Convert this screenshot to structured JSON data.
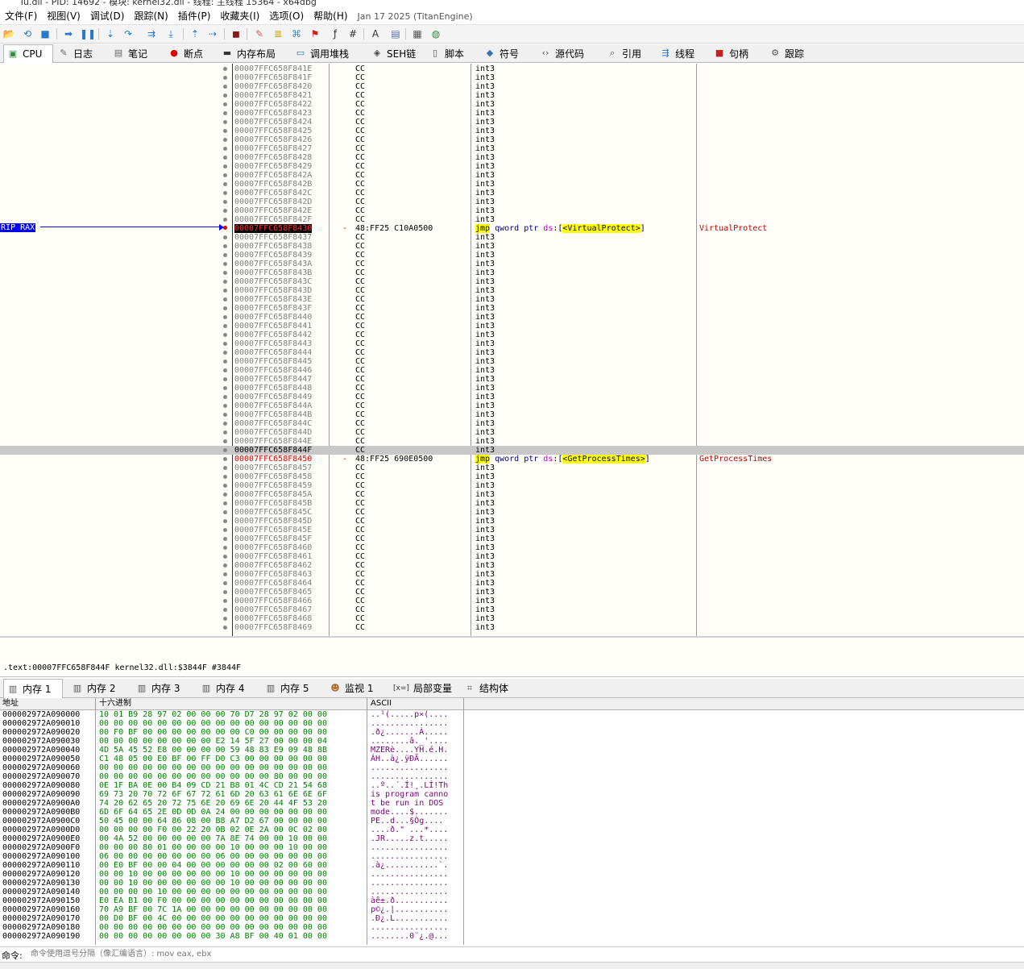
{
  "window": {
    "title": "Tu.dll - PID: 14692 - 模块: kernel32.dll - 线程: 主线程 15364 - x64dbg"
  },
  "menu": {
    "items": [
      "文件(F)",
      "视图(V)",
      "调试(D)",
      "跟踪(N)",
      "插件(P)",
      "收藏夹(I)",
      "选项(O)",
      "帮助(H)"
    ],
    "build_info": "Jan 17 2025 (TitanEngine)"
  },
  "toolbar": {
    "icons": [
      "open-icon",
      "restart-icon",
      "stop-icon",
      "run-icon",
      "pause-icon",
      "step-into-icon",
      "step-over-icon",
      "trace-into-icon",
      "trace-over-icon",
      "execute-till-return-icon",
      "run-to-user-code-icon",
      "scylla-icon",
      "comment-icon",
      "label-icon",
      "bookmark-icon",
      "function-icon",
      "hash-icon",
      "fx-icon",
      "font-icon",
      "patch-icon",
      "calculator-icon",
      "globe-icon"
    ]
  },
  "tabs": [
    {
      "label": "CPU",
      "icon": "cpu-icon",
      "active": true
    },
    {
      "label": "日志",
      "icon": "log-icon"
    },
    {
      "label": "笔记",
      "icon": "notes-icon"
    },
    {
      "label": "断点",
      "icon": "breakpoint-icon"
    },
    {
      "label": "内存布局",
      "icon": "memory-map-icon"
    },
    {
      "label": "调用堆栈",
      "icon": "call-stack-icon"
    },
    {
      "label": "SEH链",
      "icon": "seh-icon"
    },
    {
      "label": "脚本",
      "icon": "script-icon"
    },
    {
      "label": "符号",
      "icon": "symbols-icon"
    },
    {
      "label": "源代码",
      "icon": "source-icon"
    },
    {
      "label": "引用",
      "icon": "references-icon"
    },
    {
      "label": "线程",
      "icon": "threads-icon"
    },
    {
      "label": "句柄",
      "icon": "handles-icon"
    },
    {
      "label": "跟踪",
      "icon": "trace-icon"
    }
  ],
  "disasm": {
    "rip_label": "RIP RAX",
    "rows": [
      {
        "addr": "00007FFC658F841E",
        "bytes": "CC",
        "instr": "int3"
      },
      {
        "addr": "00007FFC658F841F",
        "bytes": "CC",
        "instr": "int3"
      },
      {
        "addr": "00007FFC658F8420",
        "bytes": "CC",
        "instr": "int3"
      },
      {
        "addr": "00007FFC658F8421",
        "bytes": "CC",
        "instr": "int3"
      },
      {
        "addr": "00007FFC658F8422",
        "bytes": "CC",
        "instr": "int3"
      },
      {
        "addr": "00007FFC658F8423",
        "bytes": "CC",
        "instr": "int3"
      },
      {
        "addr": "00007FFC658F8424",
        "bytes": "CC",
        "instr": "int3"
      },
      {
        "addr": "00007FFC658F8425",
        "bytes": "CC",
        "instr": "int3"
      },
      {
        "addr": "00007FFC658F8426",
        "bytes": "CC",
        "instr": "int3"
      },
      {
        "addr": "00007FFC658F8427",
        "bytes": "CC",
        "instr": "int3"
      },
      {
        "addr": "00007FFC658F8428",
        "bytes": "CC",
        "instr": "int3"
      },
      {
        "addr": "00007FFC658F8429",
        "bytes": "CC",
        "instr": "int3"
      },
      {
        "addr": "00007FFC658F842A",
        "bytes": "CC",
        "instr": "int3"
      },
      {
        "addr": "00007FFC658F842B",
        "bytes": "CC",
        "instr": "int3"
      },
      {
        "addr": "00007FFC658F842C",
        "bytes": "CC",
        "instr": "int3"
      },
      {
        "addr": "00007FFC658F842D",
        "bytes": "CC",
        "instr": "int3"
      },
      {
        "addr": "00007FFC658F842E",
        "bytes": "CC",
        "instr": "int3"
      },
      {
        "addr": "00007FFC658F842F",
        "bytes": "CC",
        "instr": "int3"
      },
      {
        "addr": "00007FFC658F8430",
        "bytes": "48:FF25 C10A0500",
        "instr": "jmp qword ptr ds:[<VirtualProtect>]",
        "op": "jmp",
        "mid": " qword ptr ",
        "seg": "ds",
        "sym": "<VirtualProtect>",
        "comment": "VirtualProtect",
        "rip": true,
        "arrow": "-"
      },
      {
        "addr": "00007FFC658F8437",
        "bytes": "CC",
        "instr": "int3"
      },
      {
        "addr": "00007FFC658F8438",
        "bytes": "CC",
        "instr": "int3"
      },
      {
        "addr": "00007FFC658F8439",
        "bytes": "CC",
        "instr": "int3"
      },
      {
        "addr": "00007FFC658F843A",
        "bytes": "CC",
        "instr": "int3"
      },
      {
        "addr": "00007FFC658F843B",
        "bytes": "CC",
        "instr": "int3"
      },
      {
        "addr": "00007FFC658F843C",
        "bytes": "CC",
        "instr": "int3"
      },
      {
        "addr": "00007FFC658F843D",
        "bytes": "CC",
        "instr": "int3"
      },
      {
        "addr": "00007FFC658F843E",
        "bytes": "CC",
        "instr": "int3"
      },
      {
        "addr": "00007FFC658F843F",
        "bytes": "CC",
        "instr": "int3"
      },
      {
        "addr": "00007FFC658F8440",
        "bytes": "CC",
        "instr": "int3"
      },
      {
        "addr": "00007FFC658F8441",
        "bytes": "CC",
        "instr": "int3"
      },
      {
        "addr": "00007FFC658F8442",
        "bytes": "CC",
        "instr": "int3"
      },
      {
        "addr": "00007FFC658F8443",
        "bytes": "CC",
        "instr": "int3"
      },
      {
        "addr": "00007FFC658F8444",
        "bytes": "CC",
        "instr": "int3"
      },
      {
        "addr": "00007FFC658F8445",
        "bytes": "CC",
        "instr": "int3"
      },
      {
        "addr": "00007FFC658F8446",
        "bytes": "CC",
        "instr": "int3"
      },
      {
        "addr": "00007FFC658F8447",
        "bytes": "CC",
        "instr": "int3"
      },
      {
        "addr": "00007FFC658F8448",
        "bytes": "CC",
        "instr": "int3"
      },
      {
        "addr": "00007FFC658F8449",
        "bytes": "CC",
        "instr": "int3"
      },
      {
        "addr": "00007FFC658F844A",
        "bytes": "CC",
        "instr": "int3"
      },
      {
        "addr": "00007FFC658F844B",
        "bytes": "CC",
        "instr": "int3"
      },
      {
        "addr": "00007FFC658F844C",
        "bytes": "CC",
        "instr": "int3"
      },
      {
        "addr": "00007FFC658F844D",
        "bytes": "CC",
        "instr": "int3"
      },
      {
        "addr": "00007FFC658F844E",
        "bytes": "CC",
        "instr": "int3"
      },
      {
        "addr": "00007FFC658F844F",
        "bytes": "CC",
        "instr": "int3",
        "selected": true
      },
      {
        "addr": "00007FFC658F8450",
        "bytes": "48:FF25 690E0500",
        "instr": "jmp qword ptr ds:[<GetProcessTimes>]",
        "op": "jmp",
        "mid": " qword ptr ",
        "seg": "ds",
        "sym": "<GetProcessTimes>",
        "comment": "GetProcessTimes",
        "arrow": "-",
        "redaddr": true
      },
      {
        "addr": "00007FFC658F8457",
        "bytes": "CC",
        "instr": "int3"
      },
      {
        "addr": "00007FFC658F8458",
        "bytes": "CC",
        "instr": "int3"
      },
      {
        "addr": "00007FFC658F8459",
        "bytes": "CC",
        "instr": "int3"
      },
      {
        "addr": "00007FFC658F845A",
        "bytes": "CC",
        "instr": "int3"
      },
      {
        "addr": "00007FFC658F845B",
        "bytes": "CC",
        "instr": "int3"
      },
      {
        "addr": "00007FFC658F845C",
        "bytes": "CC",
        "instr": "int3"
      },
      {
        "addr": "00007FFC658F845D",
        "bytes": "CC",
        "instr": "int3"
      },
      {
        "addr": "00007FFC658F845E",
        "bytes": "CC",
        "instr": "int3"
      },
      {
        "addr": "00007FFC658F845F",
        "bytes": "CC",
        "instr": "int3"
      },
      {
        "addr": "00007FFC658F8460",
        "bytes": "CC",
        "instr": "int3"
      },
      {
        "addr": "00007FFC658F8461",
        "bytes": "CC",
        "instr": "int3"
      },
      {
        "addr": "00007FFC658F8462",
        "bytes": "CC",
        "instr": "int3"
      },
      {
        "addr": "00007FFC658F8463",
        "bytes": "CC",
        "instr": "int3"
      },
      {
        "addr": "00007FFC658F8464",
        "bytes": "CC",
        "instr": "int3"
      },
      {
        "addr": "00007FFC658F8465",
        "bytes": "CC",
        "instr": "int3"
      },
      {
        "addr": "00007FFC658F8466",
        "bytes": "CC",
        "instr": "int3"
      },
      {
        "addr": "00007FFC658F8467",
        "bytes": "CC",
        "instr": "int3"
      },
      {
        "addr": "00007FFC658F8468",
        "bytes": "CC",
        "instr": "int3"
      },
      {
        "addr": "00007FFC658F8469",
        "bytes": "CC",
        "instr": "int3"
      }
    ]
  },
  "info": {
    "text": ".text:00007FFC658F844F kernel32.dll:$3844F #3844F"
  },
  "bottom_tabs": [
    {
      "label": "内存 1",
      "icon": "memory-icon",
      "active": true
    },
    {
      "label": "内存 2",
      "icon": "memory-icon"
    },
    {
      "label": "内存 3",
      "icon": "memory-icon"
    },
    {
      "label": "内存 4",
      "icon": "memory-icon"
    },
    {
      "label": "内存 5",
      "icon": "memory-icon"
    },
    {
      "label": "监视 1",
      "icon": "watch-icon"
    },
    {
      "label": "局部变量",
      "icon": "locals-icon"
    },
    {
      "label": "结构体",
      "icon": "struct-icon"
    }
  ],
  "dump": {
    "headers": {
      "addr": "地址",
      "hex": "十六进制",
      "ascii": "ASCII"
    },
    "rows": [
      {
        "a": "000002972A090000",
        "h": "10 01 B9 28 97 02 00 00 00 70 D7 28 97 02 00 00",
        "s": "..¹(.....p×(...."
      },
      {
        "a": "000002972A090010",
        "h": "00 00 00 00 00 00 00 00 00 00 00 00 00 00 00 00",
        "s": "................"
      },
      {
        "a": "000002972A090020",
        "h": "00 F0 BF 00 00 00 00 00 00 00 C0 00 00 00 00 00",
        "s": ".ð¿.......À....."
      },
      {
        "a": "000002972A090030",
        "h": "00 00 00 00 00 00 00 00 E2 14 5F 27 00 00 00 04",
        "s": "........â._'...."
      },
      {
        "a": "000002972A090040",
        "h": "4D 5A 45 52 E8 00 00 00 00 59 48 83 E9 09 48 8B",
        "s": "MZERè....YH.é.H."
      },
      {
        "a": "000002972A090050",
        "h": "C1 48 05 00 E0 BF 00 FF D0 C3 00 00 00 00 00 00",
        "s": "ÁH..à¿.ÿÐÃ......"
      },
      {
        "a": "000002972A090060",
        "h": "00 00 00 00 00 00 00 00 00 00 00 00 00 00 00 00",
        "s": "................"
      },
      {
        "a": "000002972A090070",
        "h": "00 00 00 00 00 00 00 00 00 00 00 00 80 00 00 00",
        "s": "................"
      },
      {
        "a": "000002972A090080",
        "h": "0E 1F BA 0E 00 B4 09 CD 21 B8 01 4C CD 21 54 68",
        "s": "..º..´.Í!¸.LÍ!Th"
      },
      {
        "a": "000002972A090090",
        "h": "69 73 20 70 72 6F 67 72 61 6D 20 63 61 6E 6E 6F",
        "s": "is program canno"
      },
      {
        "a": "000002972A0900A0",
        "h": "74 20 62 65 20 72 75 6E 20 69 6E 20 44 4F 53 20",
        "s": "t be run in DOS "
      },
      {
        "a": "000002972A0900B0",
        "h": "6D 6F 64 65 2E 0D 0D 0A 24 00 00 00 00 00 00 00",
        "s": "mode....$......."
      },
      {
        "a": "000002972A0900C0",
        "h": "50 45 00 00 64 86 08 00 B8 A7 D2 67 00 00 00 00",
        "s": "PE..d...§Òg...."
      },
      {
        "a": "000002972A0900D0",
        "h": "00 00 00 00 F0 00 22 20 0B 02 0E 2A 00 0C 02 00",
        "s": "....ð.\" ...*...."
      },
      {
        "a": "000002972A0900E0",
        "h": "00 4A 52 00 00 00 00 00 7A 8E 74 00 00 10 00 00",
        "s": ".JR.....z.t....."
      },
      {
        "a": "000002972A0900F0",
        "h": "00 00 00 80 01 00 00 00 00 10 00 00 00 10 00 00",
        "s": "................"
      },
      {
        "a": "000002972A090100",
        "h": "06 00 00 00 00 00 00 00 06 00 00 00 00 00 00 00",
        "s": "................"
      },
      {
        "a": "000002972A090110",
        "h": "00 E0 BF 00 00 04 00 00 00 00 00 00 02 00 60 00",
        "s": ".à¿...........`."
      },
      {
        "a": "000002972A090120",
        "h": "00 00 10 00 00 00 00 00 00 10 00 00 00 00 00 00",
        "s": "................"
      },
      {
        "a": "000002972A090130",
        "h": "00 00 10 00 00 00 00 00 00 10 00 00 00 00 00 00",
        "s": "................"
      },
      {
        "a": "000002972A090140",
        "h": "00 00 00 00 10 00 00 00 00 00 00 00 00 00 00 00",
        "s": "................"
      },
      {
        "a": "000002972A090150",
        "h": "E0 EA B1 00 F0 00 00 00 00 00 00 00 00 00 00 00",
        "s": "àê±.ð..........."
      },
      {
        "a": "000002972A090160",
        "h": "70 A9 BF 00 7C 1A 00 00 00 00 00 00 00 00 00 00",
        "s": "p©¿.|..........."
      },
      {
        "a": "000002972A090170",
        "h": "00 D0 BF 00 4C 00 00 00 00 00 00 00 00 00 00 00",
        "s": ".Ð¿.L..........."
      },
      {
        "a": "000002972A090180",
        "h": "00 00 00 00 00 00 00 00 00 00 00 00 00 00 00 00",
        "s": "................"
      },
      {
        "a": "000002972A090190",
        "h": "00 00 00 00 00 00 00 00 30 A8 BF 00 40 01 00 00",
        "s": "........0¨¿.@..."
      }
    ]
  },
  "command": {
    "label": "命令:",
    "placeholder": "命令使用逗号分隔（像汇编语言）: mov eax, ebx"
  },
  "colors": {
    "rip": "#0000ff",
    "comment": "#c00000",
    "hex": "#008000",
    "ascii": "#800080",
    "highlight": "#ffff00",
    "addr_gray": "#808080"
  }
}
